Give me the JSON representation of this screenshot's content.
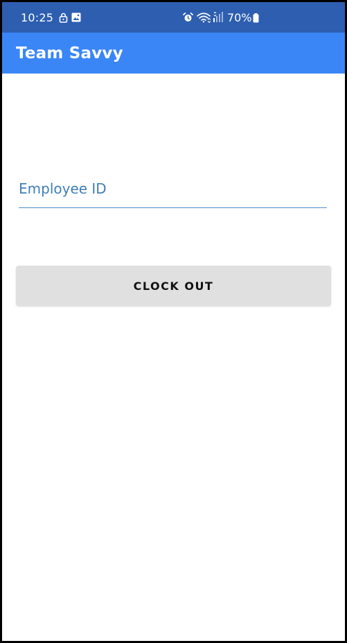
{
  "status_bar": {
    "time": "10:25",
    "battery": "70%",
    "icons": [
      "lock-icon",
      "image-icon",
      "alarm-icon",
      "wifi-icon",
      "signal-icon",
      "battery-icon"
    ],
    "background_color": "#2d5eb0"
  },
  "app_bar": {
    "title": "Team Savvy",
    "background_color": "#3a86f7"
  },
  "form": {
    "employee_id": {
      "placeholder": "Employee ID",
      "value": "",
      "accent_color": "#4a8ec8"
    },
    "clock_button": {
      "label": "CLOCK OUT",
      "background_color": "#e0e0e0"
    }
  }
}
